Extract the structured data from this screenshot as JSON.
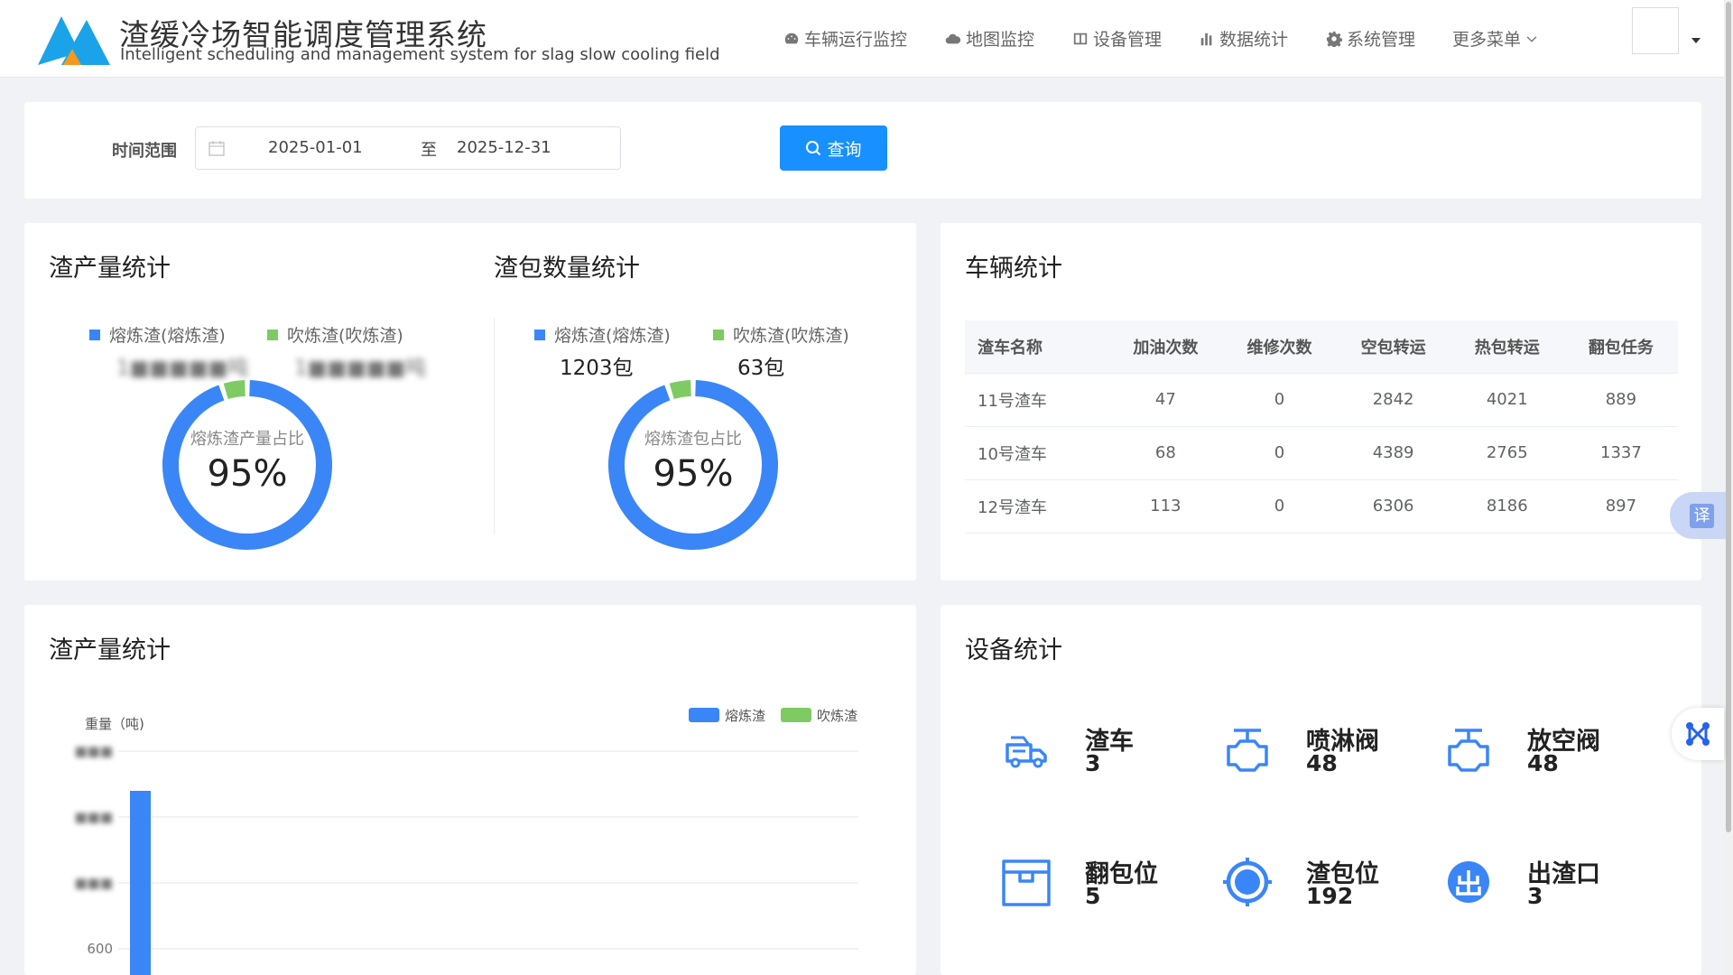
{
  "header": {
    "title_cn": "渣缓冷场智能调度管理系统",
    "title_en": "Intelligent scheduling and management system for slag slow cooling field",
    "nav": [
      {
        "label": "车辆运行监控",
        "icon": "dashboard-icon"
      },
      {
        "label": "地图监控",
        "icon": "cloud-icon"
      },
      {
        "label": "设备管理",
        "icon": "panel-icon"
      },
      {
        "label": "数据统计",
        "icon": "bar-chart-icon"
      },
      {
        "label": "系统管理",
        "icon": "gear-icon"
      },
      {
        "label": "更多菜单",
        "icon": "chevron-down-icon"
      }
    ]
  },
  "filter": {
    "label": "时间范围",
    "start_date": "2025-01-01",
    "separator": "至",
    "end_date": "2025-12-31",
    "query_label": "查询"
  },
  "slag_output": {
    "title": "渣产量统计",
    "legend": [
      {
        "name": "熔炼渣(熔炼渣)",
        "value": "1■■■■■吨",
        "color": "#3a86f7"
      },
      {
        "name": "吹炼渣(吹炼渣)",
        "value": "1■■■■■吨",
        "color": "#7ecb63"
      }
    ],
    "donut_label": "熔炼渣产量占比",
    "donut_percent": "95%",
    "ratio": 0.95
  },
  "slag_pot": {
    "title": "渣包数量统计",
    "legend": [
      {
        "name": "熔炼渣(熔炼渣)",
        "value": "1203包",
        "color": "#3a86f7"
      },
      {
        "name": "吹炼渣(吹炼渣)",
        "value": "63包",
        "color": "#7ecb63"
      }
    ],
    "donut_label": "熔炼渣包占比",
    "donut_percent": "95%",
    "ratio": 0.95
  },
  "vehicles": {
    "title": "车辆统计",
    "columns": [
      "渣车名称",
      "加油次数",
      "维修次数",
      "空包转运",
      "热包转运",
      "翻包任务"
    ],
    "rows": [
      [
        "11号渣车",
        "47",
        "0",
        "2842",
        "4021",
        "889"
      ],
      [
        "10号渣车",
        "68",
        "0",
        "4389",
        "2765",
        "1337"
      ],
      [
        "12号渣车",
        "113",
        "0",
        "6306",
        "8186",
        "897"
      ]
    ]
  },
  "chart_data": {
    "type": "bar",
    "title": "渣产量统计",
    "ylabel": "重量（吨)",
    "y_ticks": [
      "■■■",
      "■■■",
      "■■■",
      "600"
    ],
    "series": [
      {
        "name": "熔炼渣",
        "color": "#3a86f7"
      },
      {
        "name": "吹炼渣",
        "color": "#7ecb63"
      }
    ]
  },
  "devices": {
    "title": "设备统计",
    "items": [
      {
        "name": "渣车",
        "count": "3",
        "icon": "truck-icon"
      },
      {
        "name": "喷淋阀",
        "count": "48",
        "icon": "valve-icon"
      },
      {
        "name": "放空阀",
        "count": "48",
        "icon": "valve-icon"
      },
      {
        "name": "翻包位",
        "count": "5",
        "icon": "box-icon"
      },
      {
        "name": "渣包位",
        "count": "192",
        "icon": "target-icon"
      },
      {
        "name": "出渣口",
        "count": "3",
        "icon": "exit-icon"
      }
    ]
  },
  "float": {
    "translate_label": "译"
  }
}
